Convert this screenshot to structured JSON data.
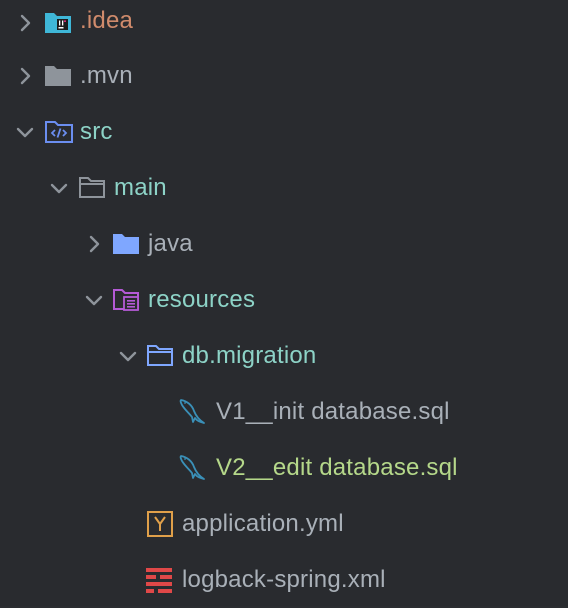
{
  "colors": {
    "background": "#292b2f",
    "folder_text": "#8dd3c7",
    "default_text": "#a9b0b8",
    "modified_text": "#b5d88a",
    "idea_text": "#d08b6c",
    "arrow": "#8e949b"
  },
  "tree": {
    "items": [
      {
        "label": ".idea",
        "icon": "idea-folder-icon",
        "expanded": false
      },
      {
        "label": ".mvn",
        "icon": "folder-icon",
        "expanded": false
      },
      {
        "label": "src",
        "icon": "source-folder-icon",
        "expanded": true
      },
      {
        "label": "main",
        "icon": "folder-outline-icon",
        "expanded": true
      },
      {
        "label": "java",
        "icon": "java-folder-icon",
        "expanded": false
      },
      {
        "label": "resources",
        "icon": "resources-folder-icon",
        "expanded": true
      },
      {
        "label": "db.migration",
        "icon": "folder-outline-icon",
        "expanded": true
      },
      {
        "label": "V1__init database.sql",
        "icon": "mysql-dolphin-icon"
      },
      {
        "label": "V2__edit database.sql",
        "icon": "mysql-dolphin-icon"
      },
      {
        "label": "application.yml",
        "icon": "yaml-file-icon"
      },
      {
        "label": "logback-spring.xml",
        "icon": "xml-file-icon"
      }
    ]
  }
}
